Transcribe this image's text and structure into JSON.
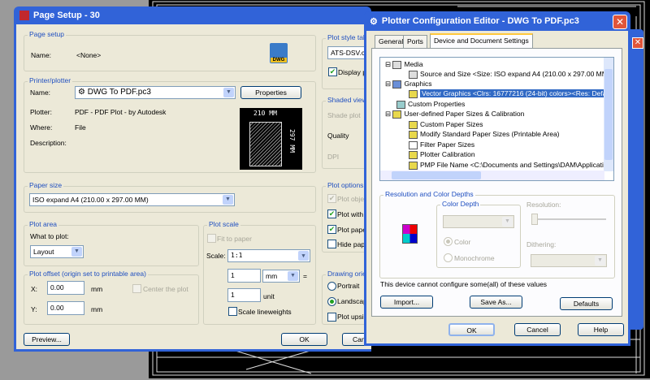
{
  "page_setup": {
    "title": "Page Setup - 30",
    "page_setup_group": "Page setup",
    "name_label": "Name:",
    "name_value": "<None>",
    "dwg_icon_text": "DWG",
    "printer_group": "Printer/plotter",
    "printer_name_label": "Name:",
    "printer_name": "DWG To PDF.pc3",
    "properties_button": "Properties",
    "plotter_label": "Plotter:",
    "plotter_value": "PDF - PDF Plot - by Autodesk",
    "where_label": "Where:",
    "where_value": "File",
    "description_label": "Description:",
    "preview_width": "210 MM",
    "preview_height": "297 MM",
    "paper_size_group": "Paper size",
    "paper_size": "ISO expand A4 (210.00 x 297.00 MM)",
    "plot_area_group": "Plot area",
    "what_to_plot_label": "What to plot:",
    "what_to_plot": "Layout",
    "plot_offset_group": "Plot offset (origin set to printable area)",
    "x_label": "X:",
    "x_value": "0.00",
    "y_label": "Y:",
    "y_value": "0.00",
    "mm": "mm",
    "center_plot": "Center the plot",
    "plot_scale_group": "Plot scale",
    "fit_to_paper": "Fit to paper",
    "scale_label": "Scale:",
    "scale_value": "1:1",
    "scale_num": "1",
    "scale_unit": "mm",
    "equals": "=",
    "scale_den": "1",
    "unit_label": "unit",
    "scale_lineweights": "Scale lineweights",
    "plot_style_group": "Plot style tab",
    "plot_style_value": "ATS-DSV.ct",
    "display_plot_styles": "Display p",
    "shaded_group": "Shaded view",
    "shade_plot": "Shade plot",
    "quality": "Quality",
    "dpi": "DPI",
    "plot_options_group": "Plot options",
    "plot_object": "Plot obje",
    "plot_with": "Plot with",
    "plot_paper": "Plot pape",
    "hide_paper": "Hide pap",
    "orientation_group": "Drawing orie",
    "portrait": "Portrait",
    "landscape": "Landscap",
    "plot_upside": "Plot upsi",
    "preview_button": "Preview...",
    "ok_button": "OK",
    "cancel_button": "Can"
  },
  "plotter_editor": {
    "title": "Plotter Configuration Editor - DWG To PDF.pc3",
    "tabs": [
      "General",
      "Ports",
      "Device and Document Settings"
    ],
    "tree": [
      "Media",
      "Source and Size <Size: ISO expand A4 (210.00 x 297.00 MM",
      "Graphics",
      "Vector Graphics <Clrs: 16777216  (24-bit) colors><Res: Defau",
      "Custom Properties",
      "User-defined Paper Sizes & Calibration",
      "Custom Paper Sizes",
      "Modify Standard Paper Sizes (Printable Area)",
      "Filter Paper Sizes",
      "Plotter Calibration",
      "PMP File Name <C:\\Documents and Settings\\DAM\\Applicati"
    ],
    "resolution_group": "Resolution and Color Depths",
    "color_depth_group": "Color Depth",
    "color": "Color",
    "monochrome": "Monochrome",
    "resolution_label": "Resolution:",
    "dithering_label": "Dithering:",
    "note": "This device cannot configure some(all) of these values",
    "import_button": "Import...",
    "save_as_button": "Save As...",
    "defaults_button": "Defaults",
    "ok_button": "OK",
    "cancel_button": "Cancel",
    "help_button": "Help"
  }
}
